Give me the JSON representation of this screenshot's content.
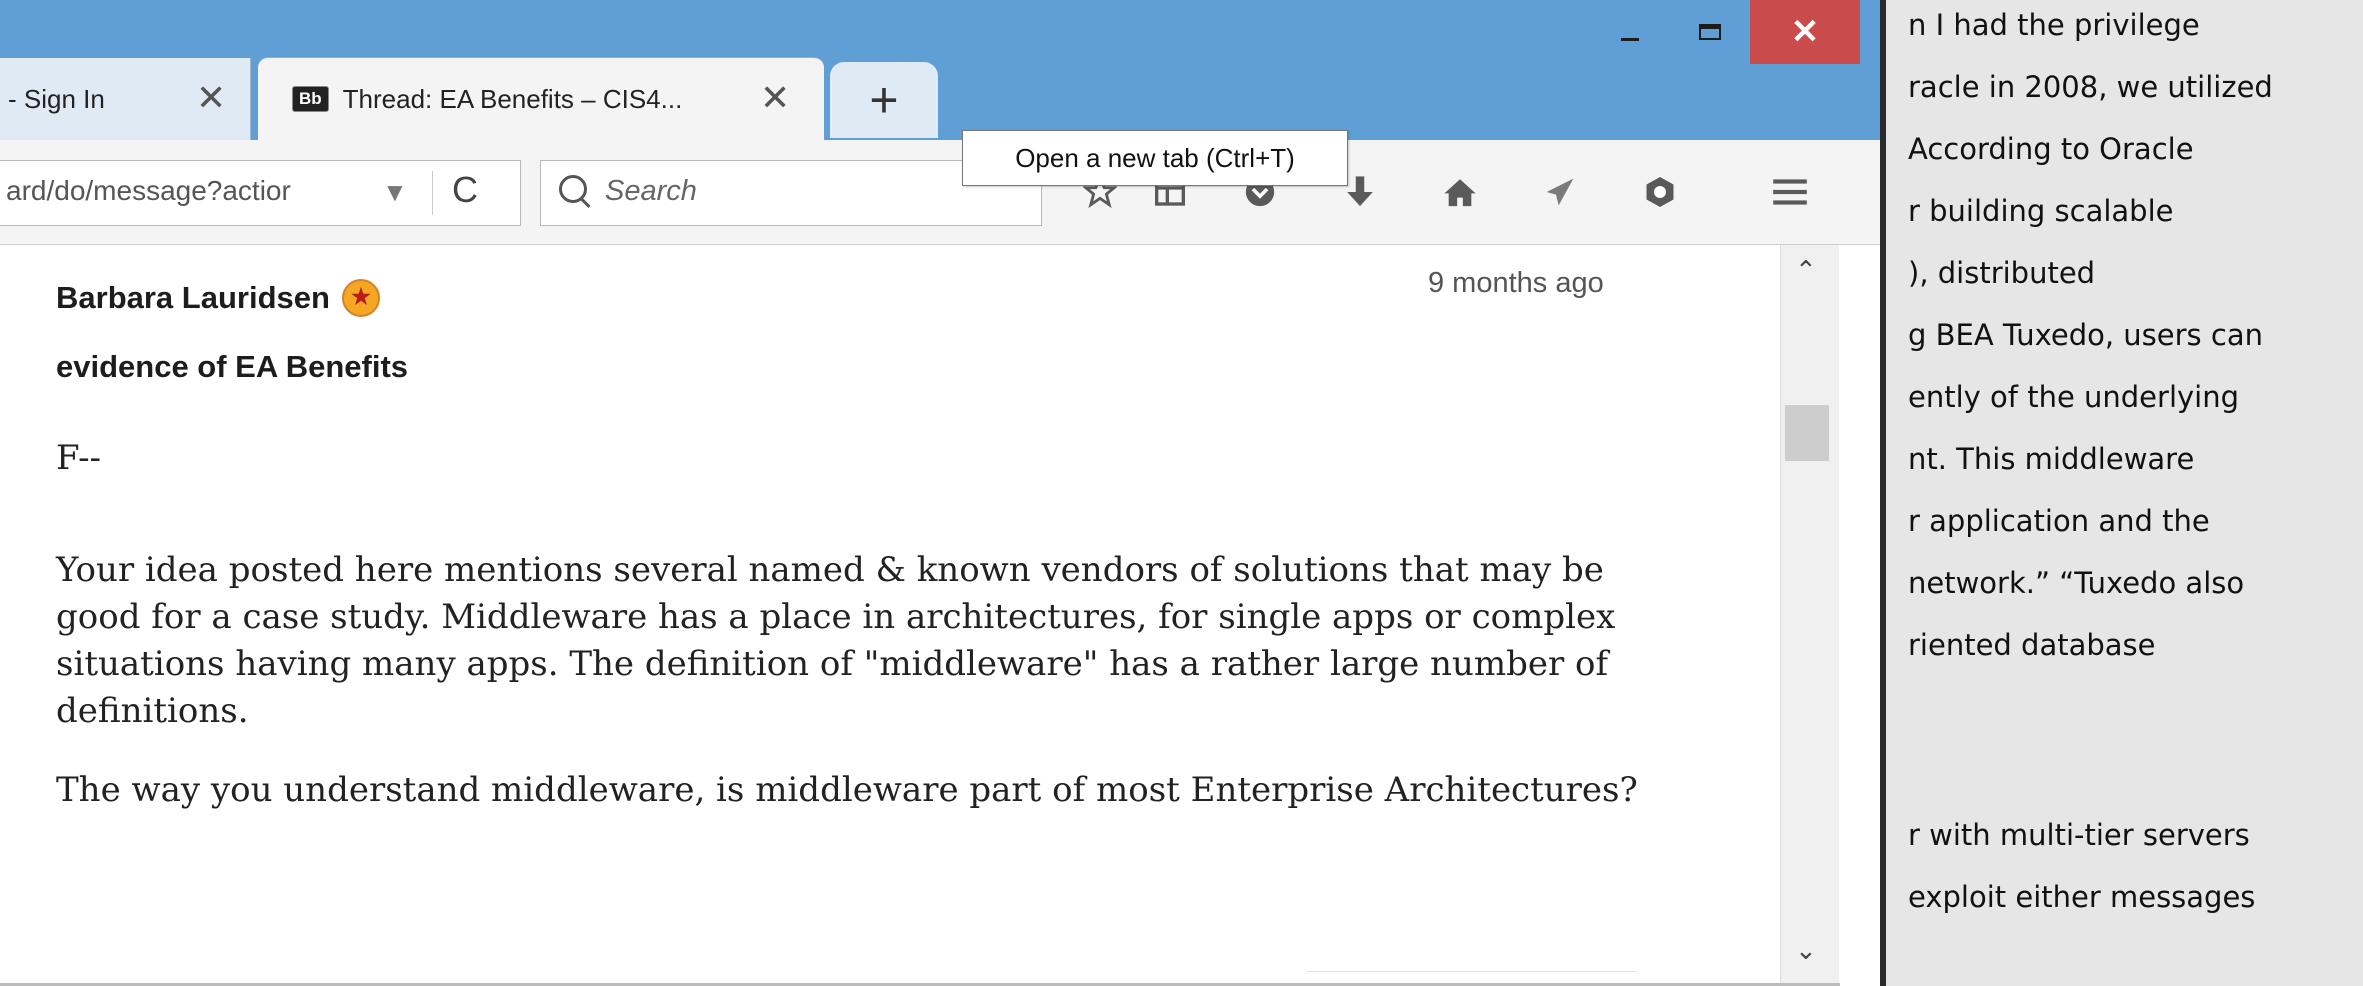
{
  "background_document": {
    "lines": [
      "n I had the privilege",
      "racle in 2008, we utilized",
      "According to Oracle",
      "r building scalable",
      "), distributed",
      "g BEA Tuxedo, users can",
      "ently of the underlying",
      "nt. This middleware",
      "r application and the",
      "network.”  “Tuxedo also",
      "riented database",
      "",
      "",
      "r with multi-tier servers",
      "exploit either messages"
    ]
  },
  "window": {
    "minimize_glyph": "–",
    "close_glyph": "✕"
  },
  "tabs": [
    {
      "label": "- Sign In",
      "close": "✕"
    },
    {
      "favicon": "Bb",
      "label": "Thread: EA Benefits – CIS4...",
      "close": "✕"
    }
  ],
  "new_tab": {
    "glyph": "+",
    "tooltip": "Open a new tab (Ctrl+T)"
  },
  "navbar": {
    "url": "ard/do/message?actior",
    "url_dropdown": "▼",
    "reload": "C",
    "search_placeholder": "Search",
    "icons": [
      "star-icon",
      "reading-list-icon",
      "pocket-icon",
      "download-icon",
      "home-icon",
      "send-icon",
      "privacy-icon",
      "menu-icon"
    ]
  },
  "post": {
    "author": "Barbara Lauridsen",
    "badge": "★",
    "timestamp": "9 months ago",
    "subject": "evidence of EA Benefits",
    "greeting": "F--",
    "paragraph1": "Your idea posted here mentions several named & known vendors of solutions that may be good for a case study. Middleware has a place in architectures, for single apps or complex situations having many apps. The definition of \"middleware\" has a rather large number of definitions.",
    "paragraph2": "The way you understand middleware, is middleware part of most Enterprise Architectures?"
  },
  "scrollbar": {
    "up": "⌃",
    "down": "⌄"
  }
}
